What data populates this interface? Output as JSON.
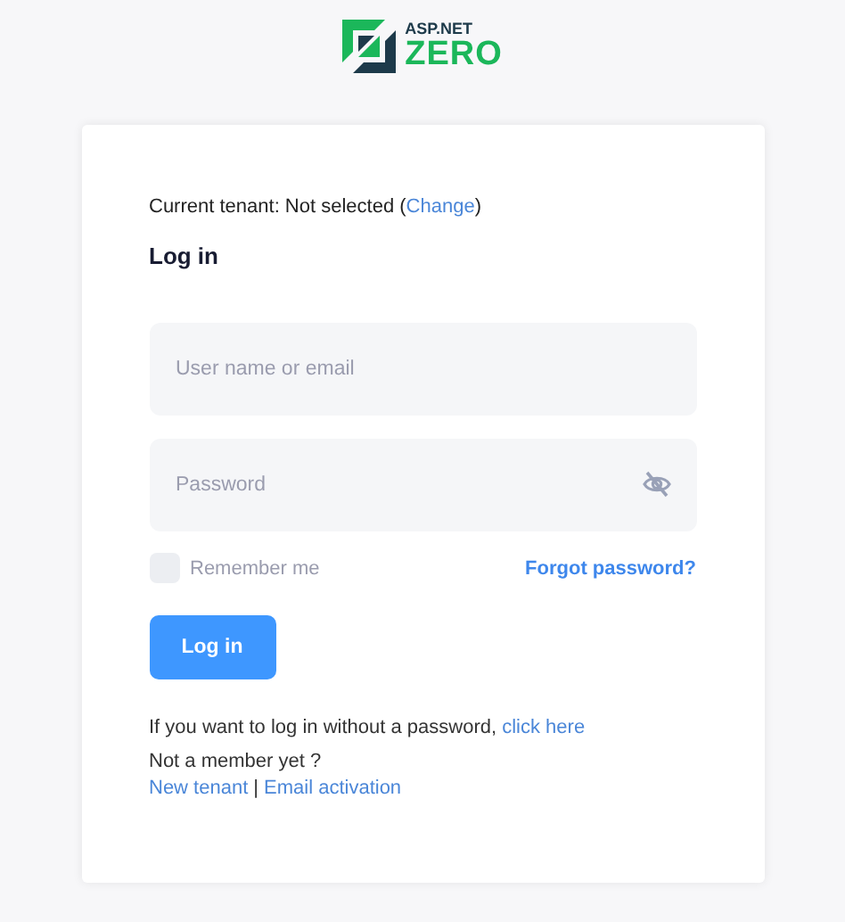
{
  "logo": {
    "line_1": "ASP.NET",
    "line_2": "ZERO"
  },
  "tenant": {
    "prefix": "Current tenant: Not selected (",
    "link": "Change",
    "suffix": ")"
  },
  "title": "Log in",
  "fields": [
    {
      "kind": "text",
      "placeholder": "User name or email"
    },
    {
      "kind": "password",
      "placeholder": "Password"
    }
  ],
  "remember": {
    "label": "Remember me",
    "checked": false
  },
  "forgot_link": "Forgot password?",
  "login_button": "Log in",
  "passwordless": {
    "text": "If you want to log in without a password, ",
    "link": "click here"
  },
  "not_member": "Not a member yet ?",
  "register_links": [
    {
      "kind": "link",
      "text": "New tenant"
    },
    {
      "kind": "separator",
      "text": "|"
    },
    {
      "kind": "link",
      "text": "Email activation"
    }
  ]
}
